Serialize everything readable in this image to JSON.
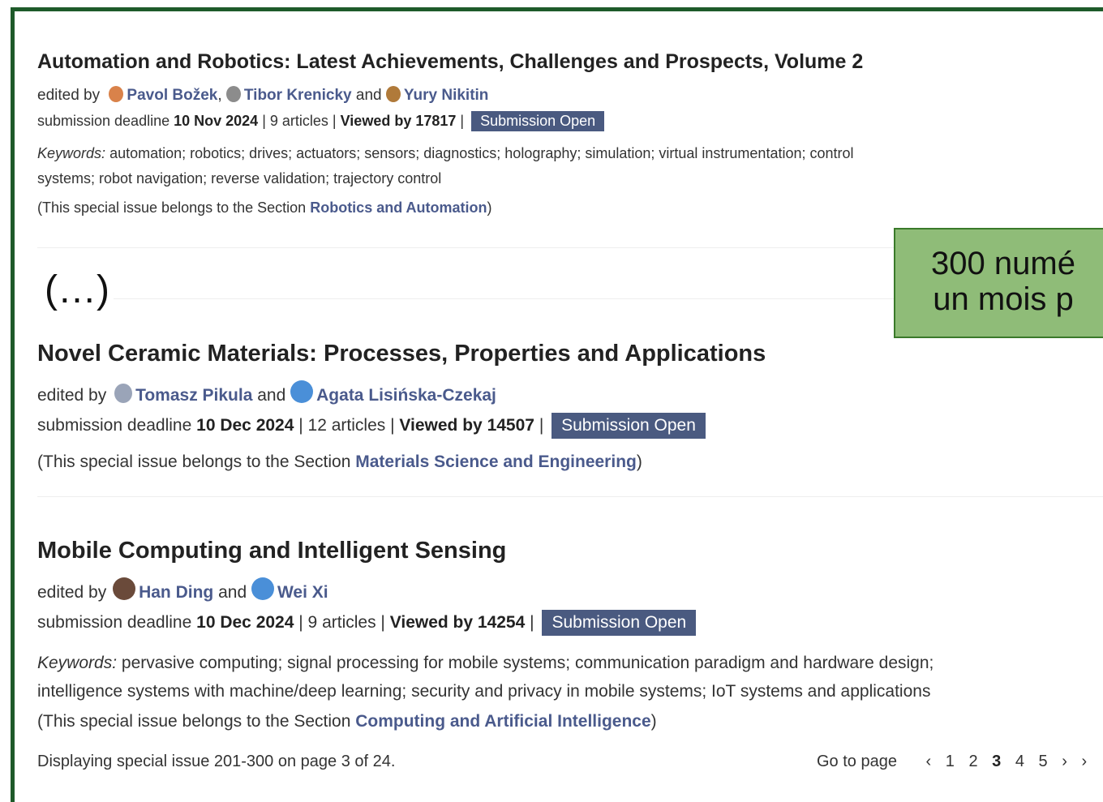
{
  "issues": [
    {
      "title": "Automation and Robotics: Latest Achievements, Challenges and Prospects, Volume 2",
      "edited_by_label": "edited by",
      "editors": [
        "Pavol Božek",
        "Tibor Krenicky",
        "Yury Nikitin"
      ],
      "sep1": ",",
      "and_label": "and",
      "deadline_label": "submission deadline",
      "deadline": "10 Nov 2024",
      "articles": "| 9 articles |",
      "viewed": "Viewed by 17817",
      "pipe": "|",
      "status": "Submission Open",
      "keywords_label": "Keywords:",
      "keywords_line1": "automation; robotics; drives; actuators; sensors; diagnostics; holography; simulation; virtual instrumentation; control",
      "keywords_line2": "systems; robot navigation; reverse validation; trajectory control",
      "section_prefix": "(This special issue belongs to the Section",
      "section": "Robotics and Automation",
      "section_suffix": ")"
    },
    {
      "title": "Novel Ceramic Materials: Processes, Properties and Applications",
      "edited_by_label": "edited by",
      "editors": [
        "Tomasz Pikula",
        "Agata Lisińska-Czekaj"
      ],
      "and_label": "and",
      "deadline_label": "submission deadline",
      "deadline": "10 Dec 2024",
      "articles": "| 12 articles |",
      "viewed": "Viewed by 14507",
      "pipe": "|",
      "status": "Submission Open",
      "section_prefix": "(This special issue belongs to the Section",
      "section": "Materials Science and Engineering",
      "section_suffix": ")"
    },
    {
      "title": "Mobile Computing and Intelligent Sensing",
      "edited_by_label": "edited by",
      "editors": [
        "Han Ding",
        "Wei Xi"
      ],
      "and_label": "and",
      "deadline_label": "submission deadline",
      "deadline": "10 Dec 2024",
      "articles": "| 9 articles |",
      "viewed": "Viewed by 14254",
      "pipe": "|",
      "status": "Submission Open",
      "keywords_label": "Keywords:",
      "keywords_line1": "pervasive computing; signal processing for mobile systems; communication paradigm and hardware design;",
      "keywords_line2": "intelligence systems with machine/deep learning; security and privacy in mobile systems; IoT systems and applications",
      "section_prefix": "(This special issue belongs to the Section",
      "section": "Computing and Artificial Intelligence",
      "section_suffix": ")"
    }
  ],
  "ellipsis": "(…)",
  "callout": {
    "line1": "300 numé",
    "line2": "un mois p"
  },
  "footer": {
    "displaying": "Displaying special issue 201-300 on page 3 of 24.",
    "go_to_page": "Go to page",
    "prev": "‹",
    "pages": [
      "1",
      "2",
      "3",
      "4",
      "5"
    ],
    "current_page": "3",
    "next": "›",
    "last": "›"
  },
  "colors": {
    "frame": "#1e5a2a",
    "badge": "#4a5a80",
    "link": "#4a5a8c",
    "callout_bg": "#8fbc78"
  }
}
